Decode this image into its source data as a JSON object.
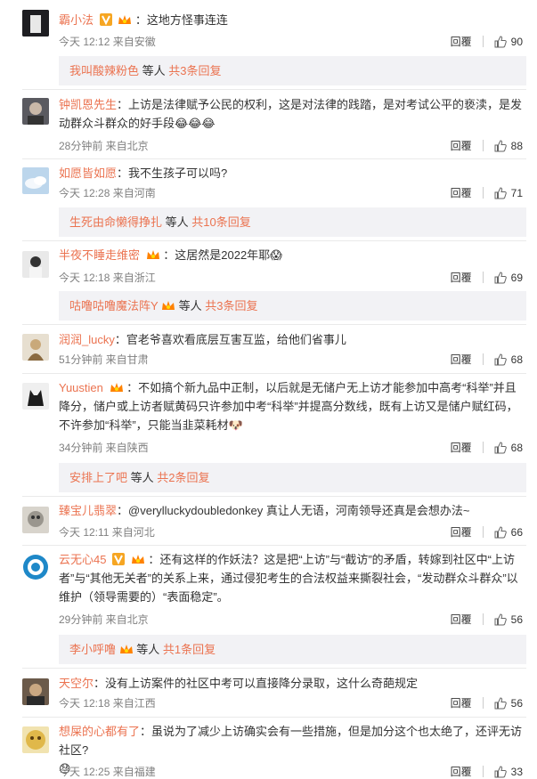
{
  "comments": [
    {
      "user": "霸小法",
      "badges": [
        "vip-v",
        "vip-crown"
      ],
      "text": "：这地方怪事连连",
      "meta": "今天 12:12 来自安徽",
      "reply_label": "回覆",
      "likes": "90",
      "replies": {
        "names": "我叫酸辣粉色",
        "suffix": " 等人 ",
        "count": "共3条回复"
      }
    },
    {
      "user": "钟凯恩先生",
      "badges": [],
      "text": "：上访是法律赋予公民的权利，这是对法律的践踏，是对考试公平的亵渎，是发动群众斗群众的好手段",
      "emoji": "😂😂😂",
      "meta": "28分钟前 来自北京",
      "reply_label": "回覆",
      "likes": "88"
    },
    {
      "user": "如愿皆如愿",
      "badges": [],
      "text": "：我不生孩子可以吗?",
      "meta": "今天 12:28 来自河南",
      "reply_label": "回覆",
      "likes": "71",
      "replies": {
        "names": "生死由命懒得挣扎",
        "suffix": " 等人 ",
        "count": "共10条回复"
      }
    },
    {
      "user": "半夜不睡走维密",
      "badges": [
        "vip-crown"
      ],
      "text": "：这居然是2022年耶",
      "emoji": "😱",
      "meta": "今天 12:18 来自浙江",
      "reply_label": "回覆",
      "likes": "69",
      "replies": {
        "names": "咕噜咕噜魔法阵Y",
        "suffix": " 等人 ",
        "count": "共3条回复"
      }
    },
    {
      "user": "润润_lucky",
      "badges": [],
      "text": "：官老爷喜欢看底层互害互监，给他们省事儿",
      "meta": "51分钟前 来自甘肃",
      "reply_label": "回覆",
      "likes": "68"
    },
    {
      "user": "Yuustien",
      "badges": [
        "vip-crown"
      ],
      "text": "：不如搞个新九品中正制，以后就是无储户无上访才能参加中高考“科举”并且降分，储户或上访者赋黄码只许参加中考“科举”并提高分数线，既有上访又是储户赋红码，不许参加“科举”，只能当韭菜耗材",
      "emoji": "🐶",
      "meta": "34分钟前 来自陕西",
      "reply_label": "回覆",
      "likes": "68",
      "replies": {
        "names": "安排上了吧",
        "suffix": " 等人 ",
        "count": "共2条回复"
      }
    },
    {
      "user": "臻宝儿翡翠",
      "badges": [],
      "text": "：@verylluckydoubledonkey 真让人无语，河南领导还真是会想办法~",
      "meta": "今天 12:11 来自河北",
      "reply_label": "回覆",
      "likes": "66"
    },
    {
      "user": "云无心45",
      "badges": [
        "vip-v",
        "vip-crown"
      ],
      "text": "：还有这样的作妖法？这是把“上访”与“截访”的矛盾，转嫁到社区中“上访者”与“其他无关者”的关系上来，通过侵犯考生的合法权益来撕裂社会，“发动群众斗群众”以维护（领导需要的）“表面稳定”。",
      "meta": "29分钟前 来自北京",
      "reply_label": "回覆",
      "likes": "56",
      "replies": {
        "names": "李小呼噜",
        "suffix": " 等人 ",
        "count": "共1条回复"
      }
    },
    {
      "user": "天空尔",
      "badges": [],
      "text": "：没有上访案件的社区中考可以直接降分录取，这什么奇葩规定",
      "meta": "今天 12:18 来自江西",
      "reply_label": "回覆",
      "likes": "56"
    },
    {
      "user": "想屎的心都有了",
      "badges": [],
      "text": "：虽说为了减少上访确实会有一些措施，但是加分这个也太绝了，还评无访社区?",
      "emoji": "😓",
      "meta": "今天 12:25 来自福建",
      "reply_label": "回覆",
      "likes": "33"
    }
  ],
  "colors": {
    "username": "#eb7350",
    "meta": "#808080",
    "reply_bg": "#f2f2f5"
  }
}
